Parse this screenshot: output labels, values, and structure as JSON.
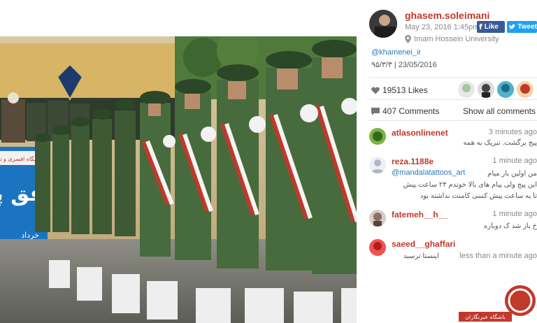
{
  "post": {
    "username": "ghasem.soleimani",
    "datetime": "May 23, 2016 1:45pm",
    "location": "Imam Hossein University",
    "caption_mention": "@khamenei_ir",
    "caption_date": "۹۵/۳/۳ | 23/05/2016",
    "likes": "19513 Likes",
    "comments_count": "407 Comments",
    "show_all": "Show all comments"
  },
  "share": {
    "facebook_label": "Like",
    "twitter_label": "Tweet"
  },
  "banner": {
    "line1": "دانشگاه افسری و تربیت پاسداری امام حسین",
    "big_text": "فق پا",
    "date_text": "خرداد"
  },
  "comments": [
    {
      "user": "atlasonlinenet",
      "time": "3 minutes ago",
      "text": "پیج برگشت. تبریک به همه"
    },
    {
      "user": "reza.1188e",
      "time": "1 minute ago",
      "mention": "@mandalatattoos_art",
      "text_line1": "من اولین بار میام",
      "text_line2": "این پیج ولی پیام های بالا خوندم ۲۴ ساعت پیش",
      "text_line3": "تا یه ساعت پیش کسی کامنت نداشته بود"
    },
    {
      "user": "fatemeh__h__",
      "time": "1 minute ago",
      "text": "خ باز شد ک دوباره"
    },
    {
      "user": "saeed__ghaffari",
      "time": "less than a minute ago",
      "text": "اینستا ترسید"
    }
  ],
  "watermark": {
    "label": "باشگاه خبرنگاران"
  },
  "colors": {
    "username_red": "#c0392b",
    "link_blue": "#2a7ab8",
    "facebook": "#3b5998",
    "twitter": "#1da1f2"
  },
  "icons": {
    "location": "map-pin-icon",
    "likes": "heart-icon",
    "comments": "comment-bubble-icon"
  }
}
